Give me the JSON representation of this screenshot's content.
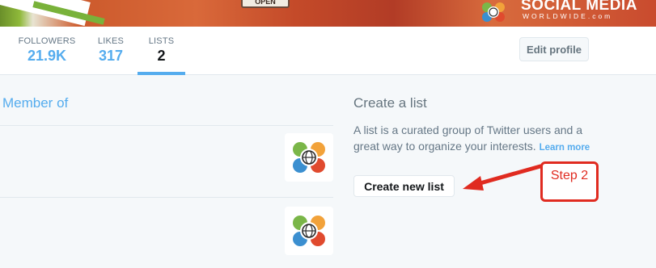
{
  "banner": {
    "sign_text": "OPEN",
    "brand_title": "SOCIAL MEDIA",
    "brand_subtitle": "WORLDWIDE.com"
  },
  "stats": {
    "followers": {
      "label": "FOLLOWERS",
      "value": "21.9K"
    },
    "likes": {
      "label": "LIKES",
      "value": "317"
    },
    "lists": {
      "label": "LISTS",
      "value": "2"
    }
  },
  "edit_profile_label": "Edit profile",
  "member_of": {
    "title": "Member of",
    "items": [
      {
        "avatar": "social-media-worldwide-logo"
      },
      {
        "avatar": "social-media-worldwide-logo"
      }
    ]
  },
  "create_list": {
    "title": "Create a list",
    "description": "A list is a curated group of Twitter users and a great way to organize your interests.",
    "learn_more": "Learn more",
    "button_label": "Create new list"
  },
  "annotation": {
    "label": "Step 2",
    "color": "#e02b20"
  },
  "colors": {
    "accent": "#55acee",
    "text_muted": "#657786",
    "background": "#f5f8fa"
  }
}
